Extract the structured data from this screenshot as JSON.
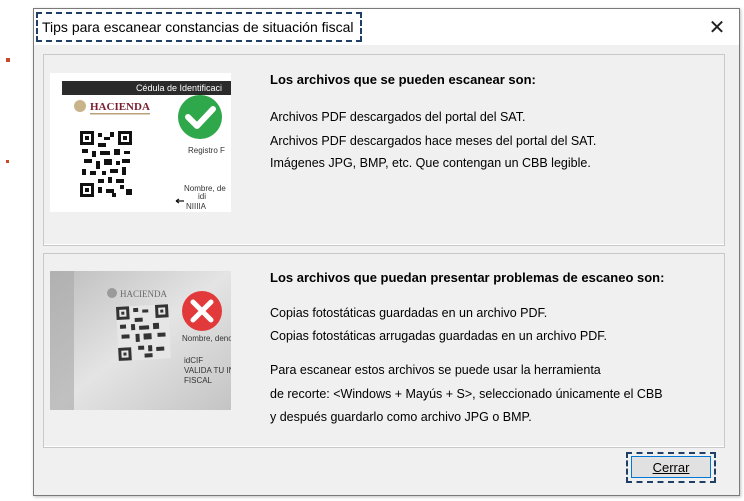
{
  "window": {
    "title": "Tips para escanear constancias de situación fiscal",
    "close_glyph": "✕"
  },
  "panel_ok": {
    "heading": "Los archivos que se pueden escanear son:",
    "lines": [
      "Archivos PDF descargados del portal del SAT.",
      "Archivos PDF descargados hace meses del portal del SAT.",
      "Imágenes JPG, BMP, etc. Que contengan un CBB legible."
    ],
    "image": {
      "doc_header": "Cédula de Identificaci",
      "brand": "HACIENDA",
      "field_registro": "Registro F",
      "field_nombre": "Nombre, de",
      "field_idi": "idi",
      "field_nuda": "NIIIIA",
      "status_icon": "check-icon",
      "status_color": "#2ea84a"
    }
  },
  "panel_problem": {
    "heading": "Los archivos que puedan presentar problemas de escaneo son:",
    "lines": [
      "Copias fotostáticas guardadas en un archivo PDF.",
      "Copias fotostáticas arrugadas guardadas en un archivo PDF."
    ],
    "tip_lines": [
      "Para escanear estos archivos se puede usar la herramienta",
      "de recorte: <Windows + Mayús + S>, seleccionado únicamente el CBB",
      "y después guardarlo como archivo JPG o BMP."
    ],
    "image": {
      "brand": "HACIENDA",
      "field_a": "Nombre, denom",
      "field_b": "idCIF",
      "field_c": "VALIDA TU INF",
      "field_d": "FISCAL",
      "status_icon": "x-icon",
      "status_color": "#e23a3a"
    }
  },
  "footer": {
    "close_button_label": "Cerrar"
  }
}
